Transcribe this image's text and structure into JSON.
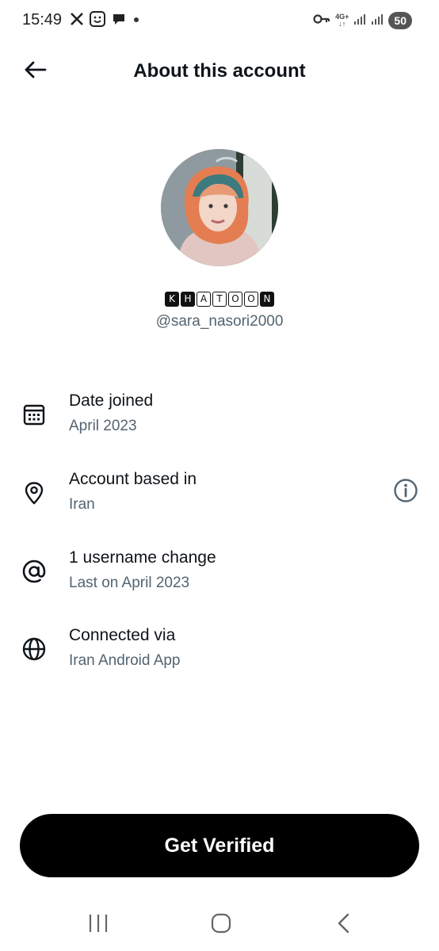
{
  "status_bar": {
    "time": "15:49",
    "battery": "50",
    "network": "4G+",
    "left_icons": [
      "x-logo-icon",
      "smiley-notification-icon",
      "chat-bubble-icon",
      "dot-icon"
    ],
    "right_icons": [
      "vpn-key-icon",
      "network-type-icon",
      "signal-icon",
      "signal-icon",
      "battery-icon"
    ]
  },
  "header": {
    "title": "About this account",
    "back_icon": "arrow-left-icon"
  },
  "profile": {
    "display_name_letters": [
      "K",
      "H",
      "A",
      "T",
      "O",
      "O",
      "N"
    ],
    "username": "@sara_nasori2000"
  },
  "info_rows": [
    {
      "icon": "calendar-icon",
      "title": "Date joined",
      "subtitle": "April 2023"
    },
    {
      "icon": "location-pin-icon",
      "title": "Account based in",
      "subtitle": "Iran",
      "action_icon": "info-icon"
    },
    {
      "icon": "at-sign-icon",
      "title": "1 username change",
      "subtitle": "Last on April 2023"
    },
    {
      "icon": "globe-icon",
      "title": "Connected via",
      "subtitle": "Iran Android App"
    }
  ],
  "verify_button": {
    "label": "Get Verified"
  },
  "nav_bar": {
    "icons": [
      "recent-apps-icon",
      "home-icon",
      "back-icon"
    ]
  },
  "colors": {
    "text_primary": "#0f1419",
    "text_secondary": "#536471",
    "button_bg": "#000000",
    "button_text": "#ffffff"
  }
}
